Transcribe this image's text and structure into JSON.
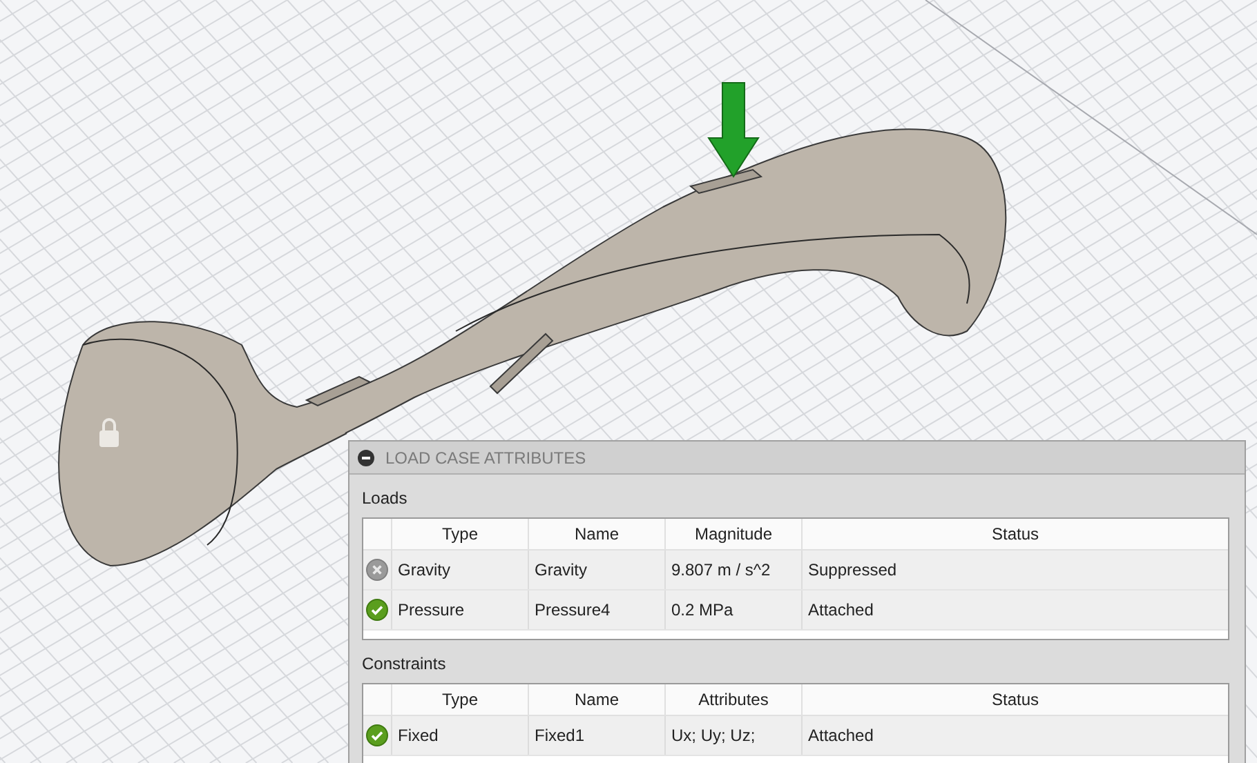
{
  "panel": {
    "title": "LOAD CASE ATTRIBUTES",
    "expanded": true,
    "sections": [
      {
        "label": "Loads",
        "columns": [
          "Type",
          "Name",
          "Magnitude",
          "Status"
        ],
        "rows": [
          {
            "kind": "suppressed",
            "cells": [
              "Gravity",
              "Gravity",
              "9.807 m / s^2",
              "Suppressed"
            ]
          },
          {
            "kind": "attached",
            "cells": [
              "Pressure",
              "Pressure4",
              "0.2 MPa",
              "Attached"
            ]
          }
        ]
      },
      {
        "label": "Constraints",
        "columns": [
          "Type",
          "Name",
          "Attributes",
          "Status"
        ],
        "rows": [
          {
            "kind": "attached",
            "cells": [
              "Fixed",
              "Fixed1",
              "Ux; Uy; Uz;",
              "Attached"
            ]
          }
        ]
      }
    ]
  }
}
